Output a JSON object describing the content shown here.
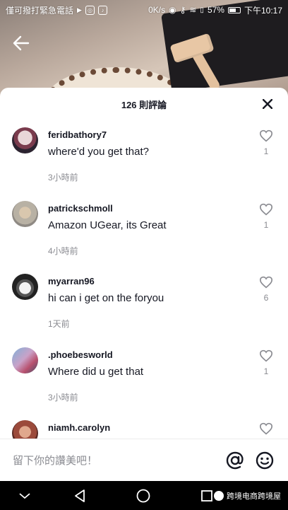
{
  "status_bar": {
    "carrier_text": "僅可撥打緊急電話",
    "network_speed": "0K/s",
    "battery_percent": "57%",
    "time": "下午10:17"
  },
  "sheet": {
    "title": "126 則評論"
  },
  "comments": [
    {
      "username": "feridbathory7",
      "text": "where'd you get that?",
      "time": "3小時前",
      "likes": "1"
    },
    {
      "username": "patrickschmoll",
      "text": "Amazon UGear, its Great",
      "time": "4小時前",
      "likes": "1"
    },
    {
      "username": "myarran96",
      "text": "hi can i get on the foryou",
      "time": "1天前",
      "likes": "6"
    },
    {
      "username": ".phoebesworld",
      "text": "Where did u get that",
      "time": "3小時前",
      "likes": "1"
    },
    {
      "username": "niamh.carolyn",
      "text": "",
      "time": "",
      "likes": ""
    }
  ],
  "input_bar": {
    "placeholder": "留下你的讚美吧！"
  },
  "watermark": {
    "text": "跨境电商跨境屋"
  },
  "colors": {
    "text_primary": "#161823",
    "text_secondary": "#8a8b91"
  }
}
